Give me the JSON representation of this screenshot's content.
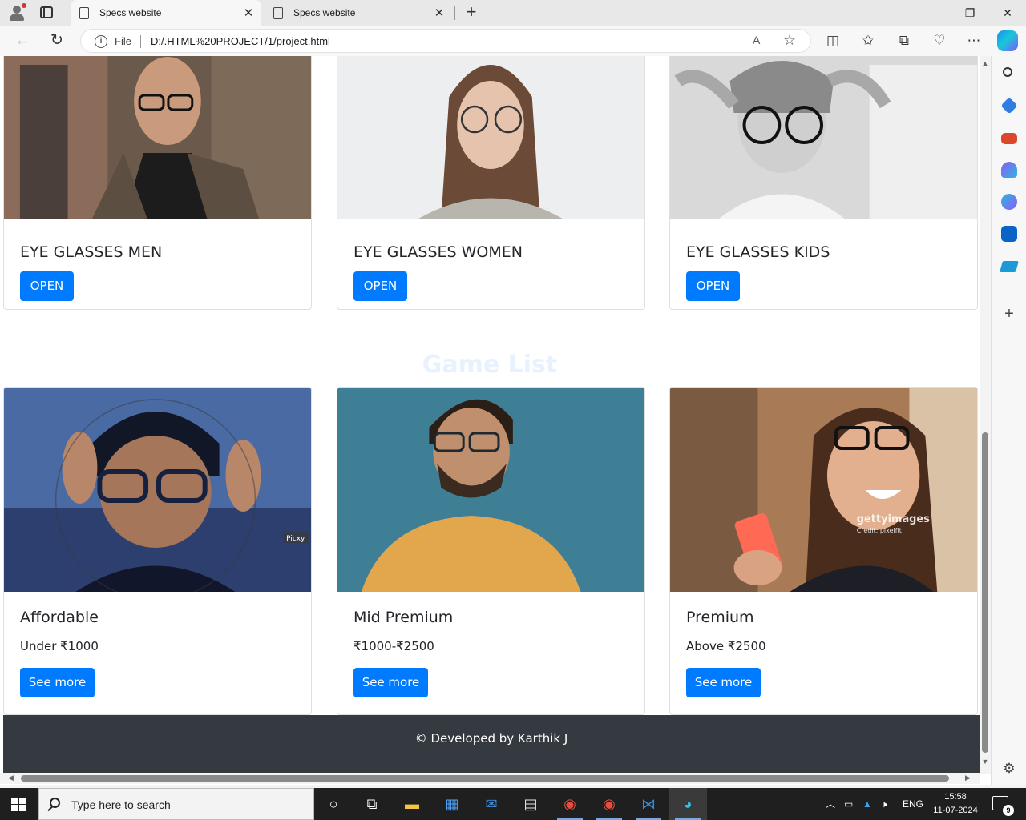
{
  "browser": {
    "tabs": [
      {
        "title": "Specs website",
        "close": "✕"
      },
      {
        "title": "Specs website",
        "close": "✕"
      }
    ],
    "new_tab": "+",
    "window_controls": {
      "minimize": "—",
      "restore": "❐",
      "close": "✕"
    },
    "address": {
      "scheme_label": "File",
      "url": "D:/.HTML%20PROJECT/1/project.html"
    }
  },
  "page": {
    "categories": [
      {
        "title": "EYE GLASSES MEN",
        "button": "OPEN",
        "image": "man-with-glasses-photo"
      },
      {
        "title": "EYE GLASSES WOMEN",
        "button": "OPEN",
        "image": "woman-with-glasses-photo"
      },
      {
        "title": "EYE GLASSES KIDS",
        "button": "OPEN",
        "image": "kid-with-glasses-photo"
      }
    ],
    "section_title": "Game List",
    "price_cards": [
      {
        "title": "Affordable",
        "text": "Under ₹1000",
        "button": "See more",
        "image": "boy-with-glasses-photo"
      },
      {
        "title": "Mid Premium",
        "text": "₹1000-₹2500",
        "button": "See more",
        "image": "bearded-man-photo"
      },
      {
        "title": "Premium",
        "text": "Above ₹2500",
        "button": "See more",
        "image": "laughing-woman-photo"
      }
    ],
    "image_watermarks": {
      "affordable": "Picxy",
      "premium": "gettyimages",
      "premium_credit": "Credit: pixelfit"
    },
    "footer": "© Developed by Karthik J"
  },
  "taskbar": {
    "search_placeholder": "Type here to search",
    "language": "ENG",
    "time": "15:58",
    "date": "11-07-2024",
    "notification_count": "9"
  },
  "colors": {
    "primary_button": "#007bff",
    "footer_bg": "#343a40",
    "section_title": "#e8f2ff"
  }
}
